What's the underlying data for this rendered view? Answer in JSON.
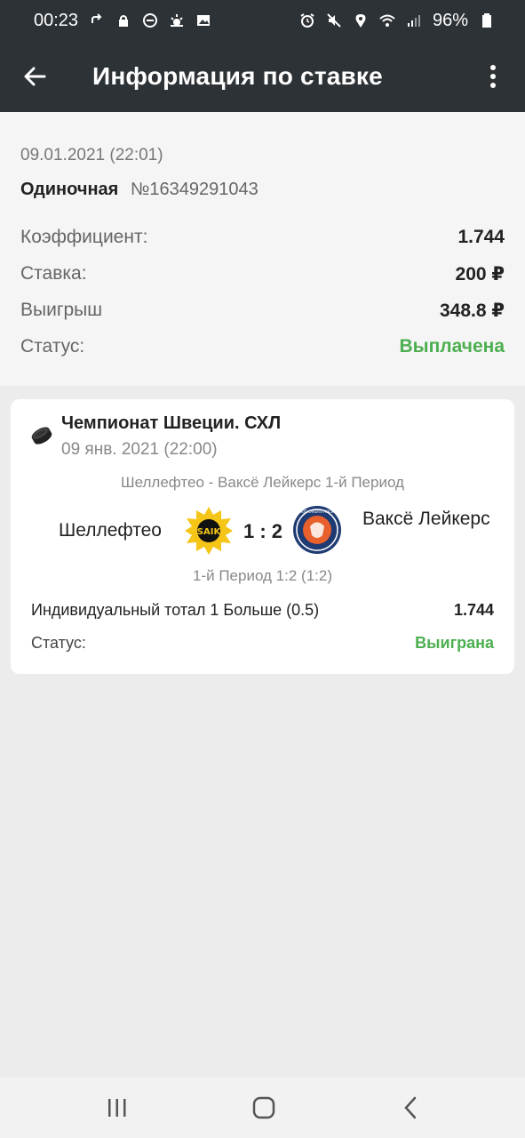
{
  "status_bar": {
    "time": "00:23",
    "battery": "96%",
    "icons": [
      "call-forward-icon",
      "lock-icon",
      "do-not-disturb-icon",
      "weather-icon",
      "image-icon",
      "alarm-icon",
      "mute-icon",
      "location-icon",
      "wifi-icon",
      "signal-icon",
      "battery-icon"
    ]
  },
  "app_bar": {
    "title": "Информация по ставке",
    "back_icon": "arrow-left-icon",
    "menu_icon": "more-vert-icon"
  },
  "bet_info": {
    "datetime": "09.01.2021 (22:01)",
    "type": "Одиночная",
    "number": "№16349291043",
    "rows": [
      {
        "label": "Коэффициент:",
        "value": "1.744"
      },
      {
        "label": "Ставка:",
        "value": "200 ₽"
      },
      {
        "label": "Выигрыш",
        "value": "348.8 ₽"
      },
      {
        "label": "Статус:",
        "value": "Выплачена"
      }
    ],
    "status_color": "#4caf50"
  },
  "event": {
    "sport_icon": "hockey-puck-icon",
    "championship": "Чемпионат Швеции. СХЛ",
    "datetime": "09 янв. 2021 (22:00)",
    "match_title": "Шеллефтео - Ваксё Лейкерс 1-й Период",
    "team1": "Шеллефтео",
    "score": "1 : 2",
    "team2": "Ваксё Лейкерс",
    "team1_logo": "skelleftea-logo",
    "team2_logo": "vaxjo-lakers-logo",
    "team2_logo_text": "VÄXJÖ LAKERS HOCKEY",
    "period_score": "1-й Период 1:2 (1:2)",
    "bet_name": "Индивидуальный тотал 1 Больше (0.5)",
    "bet_odds": "1.744",
    "status_label": "Статус:",
    "status_value": "Выиграна"
  },
  "nav_bar": {
    "icons": [
      "recent-apps-icon",
      "home-icon",
      "back-icon"
    ]
  },
  "colors": {
    "header_bg": "#2d3236",
    "accent_green": "#4caf50",
    "page_bg": "#ececec"
  }
}
